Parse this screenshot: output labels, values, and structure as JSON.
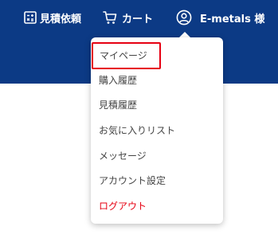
{
  "header": {
    "quote_label": "見積依頼",
    "cart_label": "カート",
    "account_label": "E-metals 様"
  },
  "menu": {
    "items": [
      {
        "label": "マイページ"
      },
      {
        "label": "購入履歴"
      },
      {
        "label": "見積履歴"
      },
      {
        "label": "お気に入りリスト"
      },
      {
        "label": "メッセージ"
      },
      {
        "label": "アカウント設定"
      },
      {
        "label": "ログアウト"
      }
    ]
  },
  "colors": {
    "header_bg": "#0c3a85",
    "highlight": "#e60012",
    "logout": "#e60012"
  }
}
